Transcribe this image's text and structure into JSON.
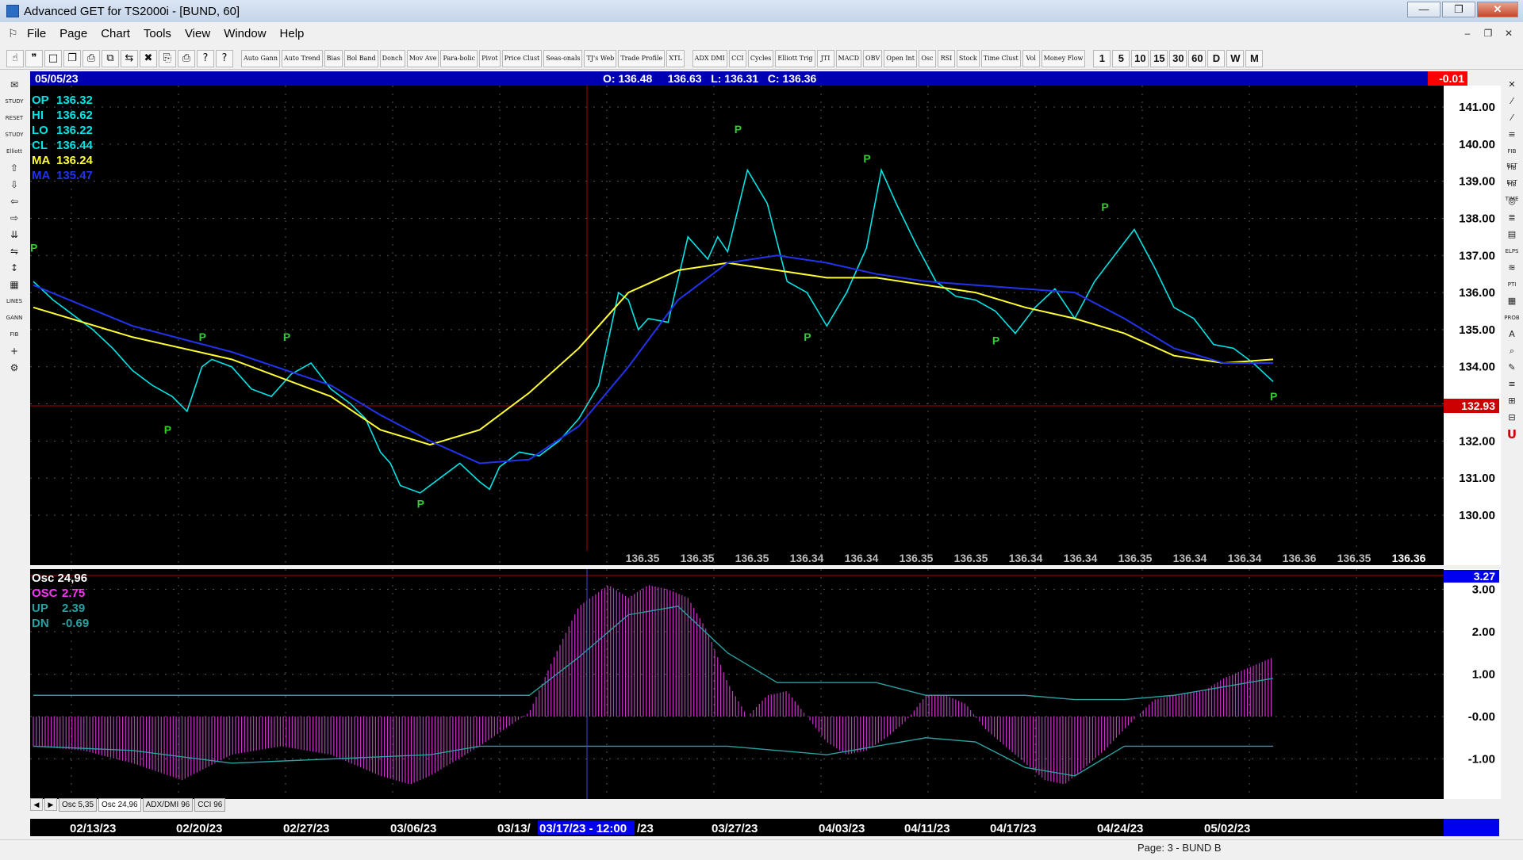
{
  "window": {
    "title": "Advanced GET for TS2000i - [BUND, 60]",
    "buttons": [
      "—",
      "❐",
      "✕"
    ]
  },
  "menu": {
    "items": [
      "File",
      "Page",
      "Chart",
      "Tools",
      "View",
      "Window",
      "Help"
    ],
    "mdi_buttons": [
      "–",
      "❐",
      "✕"
    ]
  },
  "toolbar": {
    "icon_buttons_left": [
      "☝",
      "❞",
      "□",
      "❐",
      "⎙",
      "⧉",
      "⇆",
      "✖",
      "⎘",
      "⎙",
      "?",
      "?"
    ],
    "study_buttons": [
      "Auto Gann",
      "Auto Trend",
      "Bias",
      "Bol Band",
      "Donch",
      "Mov Ave",
      "Para-bolic",
      "Pivot",
      "Price Clust",
      "Seas-onals",
      "TJ's Web",
      "Trade Profile",
      "XTL"
    ],
    "indicator_buttons": [
      "ADX DMI",
      "CCI",
      "Cycles",
      "Elliott Trig",
      "JTI",
      "MACD",
      "OBV",
      "Open Int",
      "Osc",
      "RSI",
      "Stock",
      "Time Clust",
      "Vol",
      "Money Flow"
    ],
    "interval_buttons": [
      "1",
      "5",
      "10",
      "15",
      "30",
      "60",
      "D",
      "W",
      "M"
    ]
  },
  "left_tools": [
    "✉",
    "STUDY",
    "RESET",
    "STUDY",
    "Elliott",
    "⇧",
    "⇩",
    "⇦",
    "⇨",
    "⇊",
    "⇋",
    "↕",
    "▦",
    "LINES",
    "GANN",
    "FIB",
    "+",
    "⚙"
  ],
  "right_tools": [
    "✕",
    "⁄",
    "⁄",
    "≡",
    "FIB RET",
    "FIB EXT",
    "FIB TIME",
    "◎",
    "≣",
    "▤",
    "ELPS",
    "≋",
    "PTI",
    "▦",
    "PROB",
    "A",
    "⌕",
    "✎",
    "≡",
    "⊞",
    "⊟",
    "U"
  ],
  "price_panel": {
    "date": "05/05/23",
    "ohlc": "O: 136.48     136.63   L: 136.31   C: 136.36",
    "change": "-0.01",
    "readouts": [
      {
        "label": "OP",
        "value": "136.32",
        "color": "#00e5e5"
      },
      {
        "label": "HI",
        "value": "136.62",
        "color": "#00e5e5"
      },
      {
        "label": "LO",
        "value": "136.22",
        "color": "#00e5e5"
      },
      {
        "label": "CL",
        "value": "136.44",
        "color": "#00e5e5"
      },
      {
        "label": "MA",
        "value": "136.24",
        "color": "#ffff33"
      },
      {
        "label": "MA",
        "value": "135.47",
        "color": "#2233ee"
      }
    ],
    "y_ticks": [
      "141.00",
      "140.00",
      "139.00",
      "138.00",
      "137.00",
      "136.00",
      "135.00",
      "134.00",
      "133.00",
      "132.00",
      "131.00",
      "130.00"
    ],
    "price_marker": "132.93",
    "bottom_values": [
      "136.35",
      "136.35",
      "136.35",
      "136.34",
      "136.34",
      "136.35",
      "136.35",
      "136.34",
      "136.34",
      "136.35",
      "136.34",
      "136.34",
      "136.36",
      "136.35",
      "136.36"
    ]
  },
  "osc_panel": {
    "title": "Osc 24,96",
    "readouts": [
      {
        "label": "OSC",
        "value": "2.75",
        "color": "#ff33ff"
      },
      {
        "label": "UP",
        "value": "2.39",
        "color": "#2aa0a0"
      },
      {
        "label": "DN",
        "value": "-0.69",
        "color": "#2aa0a0"
      }
    ],
    "value_marker": "3.27",
    "y_ticks": [
      "3.00",
      "2.00",
      "1.00",
      "-0.00",
      "-1.00"
    ]
  },
  "tabs": [
    "Osc 5,35",
    "Osc 24,96",
    "ADX/DMI 96",
    "CCI 96"
  ],
  "x_axis": {
    "labels": [
      "02/13/23",
      "02/20/23",
      "02/27/23",
      "03/06/23",
      "03/13/",
      "03/27/23",
      "04/03/23",
      "04/11/23",
      "04/17/23",
      "04/24/23",
      "05/02/23"
    ],
    "cursor_label": "03/17/23 - 12:00",
    "cursor_suffix": "/23"
  },
  "status": {
    "page": "Page: 3 - BUND B"
  },
  "chart_data": [
    {
      "type": "line",
      "title": "BUND, 60",
      "xlabel": "",
      "ylabel": "",
      "ylim": [
        129.5,
        141.5
      ],
      "grid": true,
      "pivot_marker": "P",
      "series": [
        {
          "name": "",
          "color": "#00e5e5",
          "x": [
            0,
            4,
            8,
            12,
            16,
            20,
            24,
            28,
            31,
            34,
            36,
            40,
            44,
            48,
            52,
            56,
            60,
            64,
            67,
            70,
            72,
            74,
            78,
            82,
            86,
            90,
            92,
            94,
            98,
            102,
            106,
            110,
            114,
            118,
            120,
            122,
            124,
            128,
            132,
            136,
            138,
            140,
            144,
            148,
            152,
            156,
            160,
            164,
            168,
            171,
            174,
            178,
            182,
            186,
            190,
            194,
            198,
            202,
            206,
            210,
            214,
            218,
            222,
            226,
            230,
            234,
            238,
            242,
            246,
            250
          ],
          "y": [
            136.3,
            135.8,
            135.4,
            135.0,
            134.5,
            133.9,
            133.5,
            133.2,
            132.8,
            134.0,
            134.2,
            134.0,
            133.4,
            133.2,
            133.8,
            134.1,
            133.4,
            133.0,
            132.6,
            131.7,
            131.4,
            130.8,
            130.6,
            131.0,
            131.4,
            130.9,
            130.7,
            131.3,
            131.7,
            131.6,
            132.0,
            132.6,
            133.5,
            136.0,
            135.8,
            135.0,
            135.3,
            135.2,
            137.5,
            136.9,
            137.5,
            137.1,
            139.3,
            138.4,
            136.3,
            136.0,
            135.1,
            136.0,
            137.2,
            139.3,
            138.4,
            137.3,
            136.3,
            135.9,
            135.8,
            135.5,
            134.9,
            135.6,
            136.1,
            135.3,
            136.3,
            137.0,
            137.7,
            136.7,
            135.6,
            135.3,
            134.6,
            134.5,
            134.1,
            133.6
          ]
        },
        {
          "name": "",
          "color": "#ffff33",
          "x": [
            0,
            20,
            40,
            60,
            70,
            80,
            90,
            100,
            110,
            120,
            130,
            140,
            150,
            160,
            170,
            180,
            190,
            200,
            210,
            220,
            230,
            240,
            250
          ],
          "y": [
            135.6,
            134.8,
            134.2,
            133.2,
            132.3,
            131.9,
            132.3,
            133.3,
            134.5,
            136.0,
            136.6,
            136.8,
            136.6,
            136.4,
            136.4,
            136.2,
            136.0,
            135.6,
            135.3,
            134.9,
            134.3,
            134.1,
            134.2
          ]
        },
        {
          "name": "",
          "color": "#2233ee",
          "x": [
            0,
            20,
            40,
            60,
            70,
            80,
            90,
            100,
            110,
            120,
            130,
            140,
            150,
            160,
            170,
            180,
            190,
            200,
            210,
            220,
            230,
            240,
            250
          ],
          "y": [
            136.2,
            135.1,
            134.4,
            133.5,
            132.7,
            132.0,
            131.4,
            131.5,
            132.4,
            134.0,
            135.8,
            136.8,
            137.0,
            136.8,
            136.5,
            136.3,
            136.2,
            136.1,
            136.0,
            135.3,
            134.5,
            134.1,
            134.1
          ]
        }
      ]
    },
    {
      "type": "bar",
      "title": "Osc 24,96",
      "xlabel": "",
      "ylabel": "",
      "ylim": [
        -1.6,
        3.3
      ],
      "grid": true,
      "series": [
        {
          "name": "OSC",
          "color": "#cc33cc",
          "x": [
            0,
            10,
            20,
            30,
            40,
            50,
            60,
            70,
            76,
            80,
            90,
            100,
            105,
            110,
            116,
            120,
            124,
            128,
            132,
            136,
            140,
            144,
            148,
            152,
            156,
            160,
            164,
            168,
            172,
            176,
            180,
            184,
            188,
            192,
            196,
            200,
            204,
            208,
            212,
            216,
            220,
            226,
            230,
            236,
            240,
            246,
            250
          ],
          "y": [
            -0.7,
            -0.8,
            -1.1,
            -1.5,
            -0.9,
            -0.7,
            -0.9,
            -1.4,
            -1.6,
            -1.4,
            -0.7,
            0.1,
            1.4,
            2.6,
            3.1,
            2.8,
            3.1,
            3.0,
            2.8,
            2.0,
            0.8,
            0.0,
            0.5,
            0.6,
            0.0,
            -0.6,
            -0.9,
            -0.8,
            -0.5,
            -0.1,
            0.5,
            0.5,
            0.3,
            -0.3,
            -0.7,
            -1.1,
            -1.5,
            -1.6,
            -1.2,
            -0.8,
            -0.3,
            0.4,
            0.5,
            0.6,
            0.9,
            1.2,
            1.4
          ]
        },
        {
          "name": "UP",
          "color": "#2aa0a0",
          "x": [
            0,
            60,
            90,
            100,
            110,
            120,
            130,
            140,
            150,
            160,
            170,
            180,
            190,
            200,
            210,
            220,
            230,
            240,
            250
          ],
          "y": [
            0.5,
            0.5,
            0.5,
            0.5,
            1.4,
            2.4,
            2.6,
            1.5,
            0.8,
            0.8,
            0.8,
            0.5,
            0.5,
            0.5,
            0.4,
            0.4,
            0.5,
            0.7,
            0.9
          ]
        },
        {
          "name": "DN",
          "color": "#2aa0a0",
          "x": [
            0,
            20,
            40,
            60,
            80,
            90,
            100,
            110,
            120,
            130,
            140,
            150,
            160,
            170,
            180,
            190,
            200,
            210,
            220,
            230,
            240,
            250
          ],
          "y": [
            -0.7,
            -0.8,
            -1.1,
            -1.0,
            -0.9,
            -0.7,
            -0.7,
            -0.7,
            -0.7,
            -0.7,
            -0.7,
            -0.8,
            -0.9,
            -0.7,
            -0.5,
            -0.6,
            -1.2,
            -1.4,
            -0.7,
            -0.7,
            -0.7,
            -0.7
          ]
        }
      ]
    }
  ]
}
